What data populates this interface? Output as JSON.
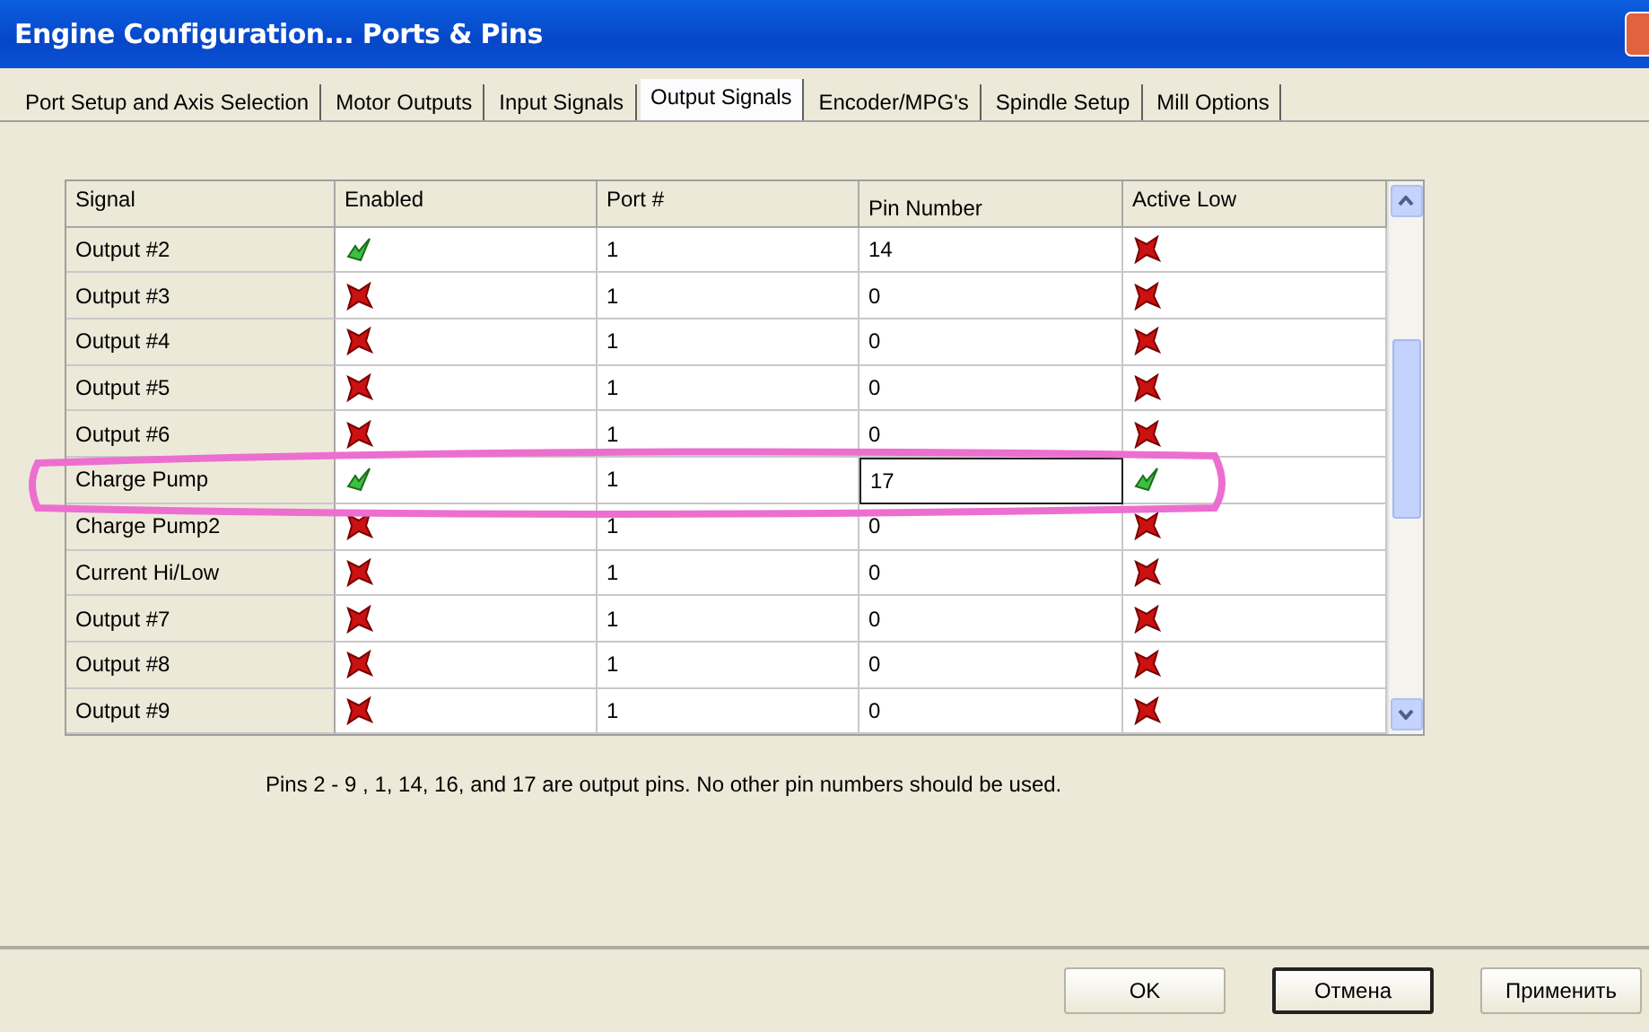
{
  "window": {
    "title": "Engine Configuration... Ports & Pins"
  },
  "tabs": [
    {
      "label": "Port Setup and Axis Selection",
      "selected": false
    },
    {
      "label": "Motor Outputs",
      "selected": false
    },
    {
      "label": "Input Signals",
      "selected": false
    },
    {
      "label": "Output Signals",
      "selected": true
    },
    {
      "label": "Encoder/MPG's",
      "selected": false
    },
    {
      "label": "Spindle Setup",
      "selected": false
    },
    {
      "label": "Mill Options",
      "selected": false
    }
  ],
  "table": {
    "columns": [
      "Signal",
      "Enabled",
      "Port #",
      "Pin Number",
      "Active Low"
    ],
    "rows": [
      {
        "signal": "Output #2",
        "enabled": true,
        "port": "1",
        "pin": "14",
        "active_low": false,
        "focused": false,
        "circled": false
      },
      {
        "signal": "Output #3",
        "enabled": false,
        "port": "1",
        "pin": "0",
        "active_low": false,
        "focused": false,
        "circled": false
      },
      {
        "signal": "Output #4",
        "enabled": false,
        "port": "1",
        "pin": "0",
        "active_low": false,
        "focused": false,
        "circled": false
      },
      {
        "signal": "Output #5",
        "enabled": false,
        "port": "1",
        "pin": "0",
        "active_low": false,
        "focused": false,
        "circled": false
      },
      {
        "signal": "Output #6",
        "enabled": false,
        "port": "1",
        "pin": "0",
        "active_low": false,
        "focused": false,
        "circled": false
      },
      {
        "signal": "Charge Pump",
        "enabled": true,
        "port": "1",
        "pin": "17",
        "active_low": true,
        "focused": true,
        "circled": true
      },
      {
        "signal": "Charge Pump2",
        "enabled": false,
        "port": "1",
        "pin": "0",
        "active_low": false,
        "focused": false,
        "circled": false
      },
      {
        "signal": "Current Hi/Low",
        "enabled": false,
        "port": "1",
        "pin": "0",
        "active_low": false,
        "focused": false,
        "circled": false
      },
      {
        "signal": "Output #7",
        "enabled": false,
        "port": "1",
        "pin": "0",
        "active_low": false,
        "focused": false,
        "circled": false
      },
      {
        "signal": "Output #8",
        "enabled": false,
        "port": "1",
        "pin": "0",
        "active_low": false,
        "focused": false,
        "circled": false
      },
      {
        "signal": "Output #9",
        "enabled": false,
        "port": "1",
        "pin": "0",
        "active_low": false,
        "focused": false,
        "circled": false
      }
    ]
  },
  "note": "Pins 2 - 9 , 1, 14, 16, and 17 are output pins. No  other pin numbers should be used.",
  "buttons": [
    {
      "label": "OK",
      "default": false
    },
    {
      "label": "Отмена",
      "default": true
    },
    {
      "label": "Применить",
      "default": false
    }
  ]
}
